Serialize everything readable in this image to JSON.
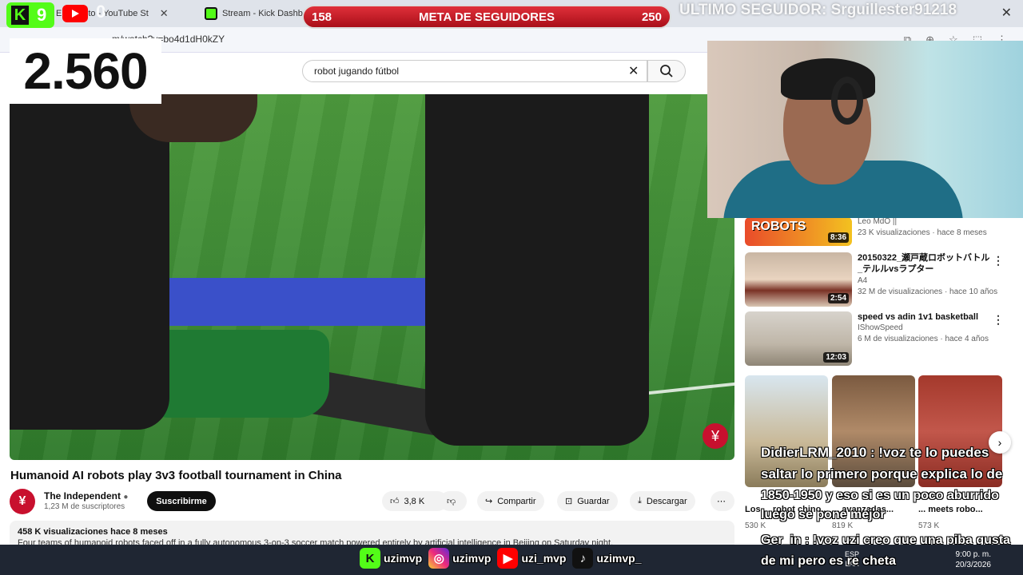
{
  "browser": {
    "tabs": [
      {
        "label": "En directo - YouTube St",
        "icon": "youtube-icon"
      },
      {
        "label": "Stream - Kick Dashbo",
        "icon": "kick-icon"
      }
    ],
    "url": "m/watch?v=bo4d1dH0kZY"
  },
  "youtube": {
    "search_query": "robot jugando fútbol",
    "video": {
      "title": "Humanoid AI robots play 3v3 football tournament in China",
      "channel": "The Independent",
      "subscribers": "1,23 M de suscriptores",
      "subscribe_label": "Suscribirme",
      "likes": "3,8 K",
      "share_label": "Compartir",
      "save_label": "Guardar",
      "download_label": "Descargar",
      "views_date": "458 K visualizaciones  hace 8 meses",
      "description_snippet": "Four teams of humanoid robots faced off in a fully autonomous 3-on-3 soccer match powered entirely by artificial intelligence in Beijing on Saturday night."
    },
    "recommendations": [
      {
        "title": "",
        "channel": "Leo MdO ||",
        "meta": "23 K visualizaciones · hace 8 meses",
        "duration": "8:36",
        "thumb_text": "ROBOTS"
      },
      {
        "title": "20150322_瀬戸蔵ロボットバトル_テルルvsラプター",
        "channel": "A4",
        "meta": "32 M de visualizaciones · hace 10 años",
        "duration": "2:54"
      },
      {
        "title": "speed vs adin 1v1 basketball",
        "channel": "IShowSpeed",
        "meta": "6 M de visualizaciones · hace 4 años",
        "duration": "12:03"
      }
    ],
    "shorts": [
      {
        "title": "Los ... robot chino...",
        "views": "530 K"
      },
      {
        "title": "... avanzadas...",
        "views": "819 K"
      },
      {
        "title": "... meets robo...",
        "views": "573 K"
      }
    ]
  },
  "overlay": {
    "viewer_count": "2.560",
    "kick_count": "9",
    "youtube_count": "0",
    "goal_label": "META DE SEGUIDORES",
    "goal_current": "158",
    "goal_target": "250",
    "goal_progress": 0.632,
    "last_follower": "ULTIMO SEGUIDOR: Srguillester91218",
    "chat": [
      "DidierLRM_2010 : !voz te lo puedes",
      "saltar lo primero porque explica lo de",
      "1850-1950 y eso si es un poco aburrido",
      "luego se pone mejor",
      "Ger_in : !voz uzi creo que una piba gusta",
      "de mi pero es re cheta"
    ],
    "socials": [
      {
        "icon": "kick-icon",
        "handle": "uzimvp"
      },
      {
        "icon": "instagram-icon",
        "handle": "uzimvp"
      },
      {
        "icon": "youtube-icon",
        "handle": "uzi_mvp"
      },
      {
        "icon": "tiktok-icon",
        "handle": "uzimvp_"
      }
    ]
  },
  "taskbar": {
    "lang": "ESP",
    "lang2": "LAA",
    "time": "9:00 p. m.",
    "date": "20/3/2026"
  },
  "colors": {
    "kick": "#53fc18",
    "youtube": "#ff0000",
    "goal": "#c8202a"
  }
}
